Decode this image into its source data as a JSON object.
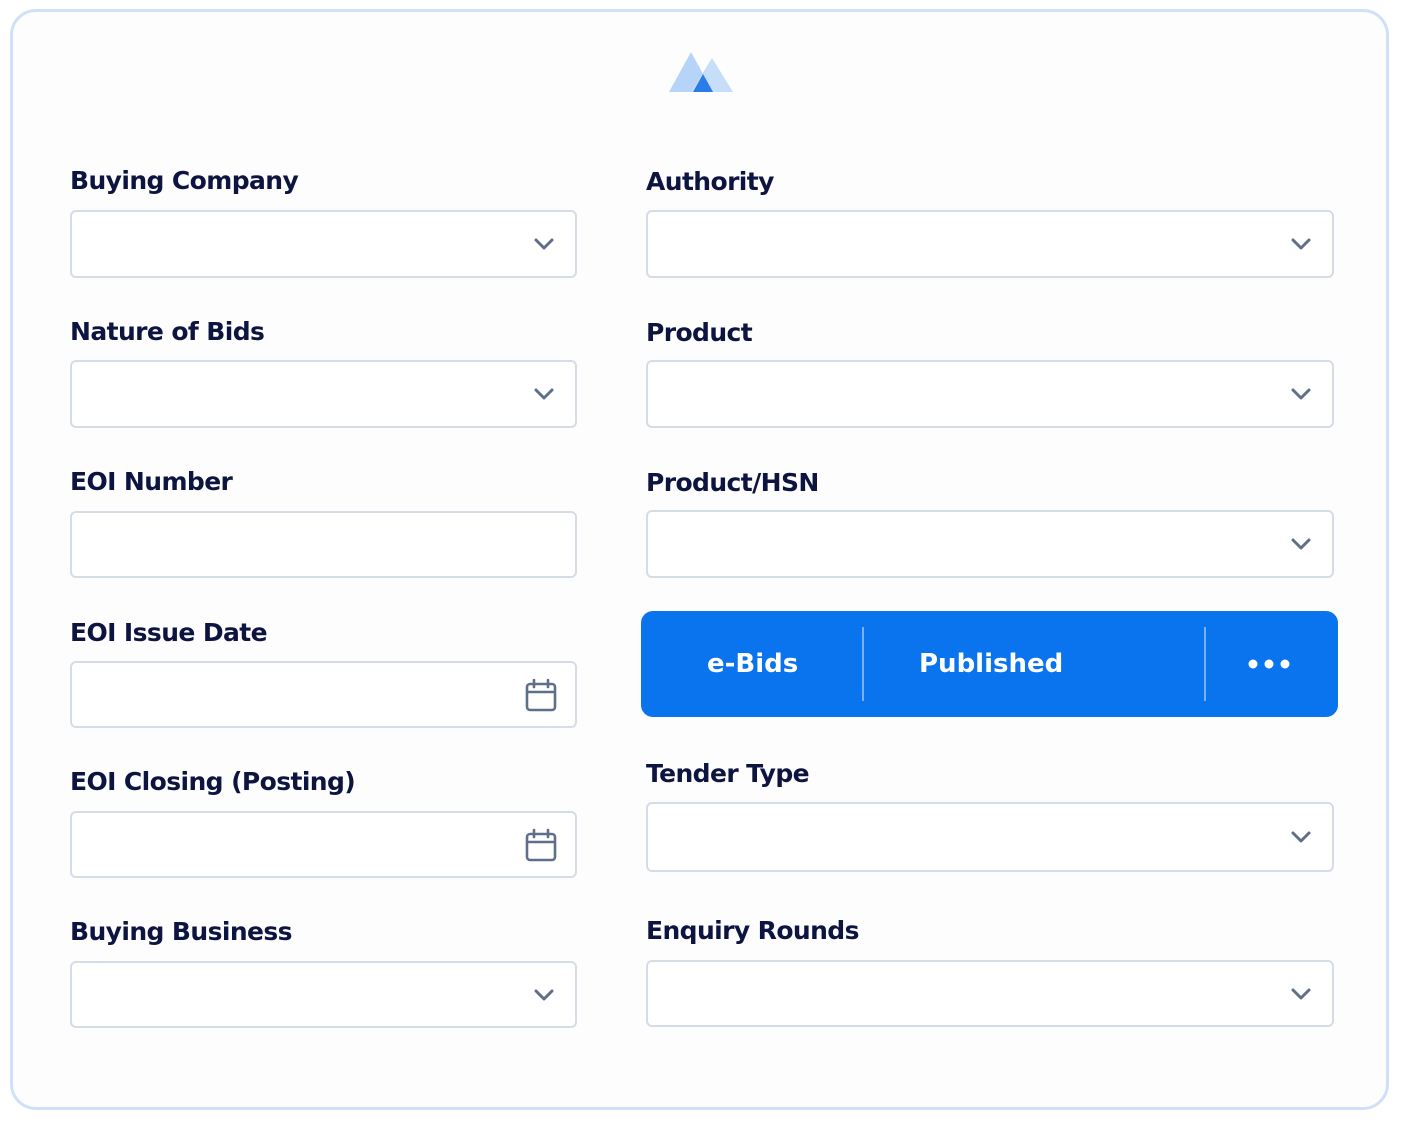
{
  "logo": {
    "icon": "mountain-logo-icon",
    "colors": [
      "#a9cdf7",
      "#7db4f2",
      "#1e73e8"
    ]
  },
  "form": {
    "left": [
      {
        "label": "Buying Company",
        "type": "select",
        "value": ""
      },
      {
        "label": "Nature of Bids",
        "type": "select",
        "value": ""
      },
      {
        "label": "EOI Number",
        "type": "text",
        "value": ""
      },
      {
        "label": "EOI Issue Date",
        "type": "date",
        "value": ""
      },
      {
        "label": "EOI Closing (Posting)",
        "type": "date",
        "value": ""
      },
      {
        "label": "Buying Business",
        "type": "select",
        "value": ""
      }
    ],
    "right": [
      {
        "label": "Authority",
        "type": "select",
        "value": ""
      },
      {
        "label": "Product",
        "type": "select",
        "value": ""
      },
      {
        "label": "Product/HSN",
        "type": "select",
        "value": ""
      },
      {
        "label": "Tender Type",
        "type": "select",
        "value": ""
      },
      {
        "label": "Enquiry Rounds",
        "type": "select",
        "value": ""
      }
    ]
  },
  "status_bar": {
    "section": "e-Bids",
    "status": "Published",
    "more_icon": "more-horizontal-icon",
    "background": "#0a73ee"
  },
  "colors": {
    "label": "#0d1440",
    "border": "#d5dce6",
    "icon": "#5f6f8a",
    "card_border": "#cfe0f7"
  }
}
